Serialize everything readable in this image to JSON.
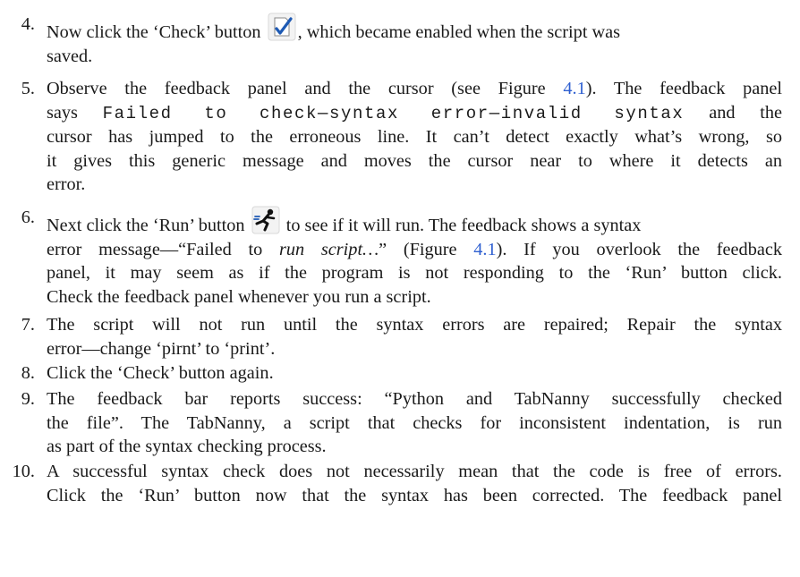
{
  "steps": [
    {
      "number": "4.",
      "lines": [
        {
          "a": "Now click the ‘Check’ button",
          "b": ", which became enabled when the script was"
        },
        {
          "a": "saved."
        }
      ],
      "icon": "check-syntax-icon"
    },
    {
      "number": "5.",
      "l1a": "Observe the feedback panel and the cursor (see Figure ",
      "l1link": "4.1",
      "l1b": "). The feedback panel",
      "l2a": "says ",
      "l2mono": "Failed to check—syntax error—invalid syntax",
      "l2b": " and the",
      "l3": "cursor has jumped to the erroneous line. It can’t detect exactly what’s wrong, so",
      "l4": "it gives this generic message and moves the cursor near to where it detects an",
      "l5": "error."
    },
    {
      "number": "6.",
      "l1a": "Next click the ‘Run’ button",
      "l1b": "to see if it will run. The feedback shows a syntax",
      "icon": "run-script-icon",
      "l2a": "error message—“Failed to ",
      "l2ital": "run script…",
      "l2b": "” (Figure ",
      "l2link": "4.1",
      "l2c": "). If you overlook the feedback",
      "l3": "panel, it may seem as if the program is not responding to the ‘Run’ button click.",
      "l4": "Check the feedback panel whenever you run a script."
    },
    {
      "number": "7.",
      "l1": "The script will not run until the syntax errors are repaired; Repair the syntax",
      "l2": "error—change ‘pirnt’ to ‘print’."
    },
    {
      "number": "8.",
      "l1": "Click the ‘Check’ button again."
    },
    {
      "number": "9.",
      "l1": "The feedback bar reports success: “Python and TabNanny successfully checked",
      "l2": "the file”. The TabNanny, a script that checks for inconsistent indentation, is run",
      "l3": "as part of the syntax checking process."
    },
    {
      "number": "10.",
      "l1": "A successful syntax check does not necessarily mean that the code is free of errors.",
      "l2": "Click the ‘Run’ button now that the syntax has been corrected. The feedback panel"
    }
  ],
  "colors": {
    "text": "#1a1a1a",
    "link": "#2e5fd0"
  }
}
